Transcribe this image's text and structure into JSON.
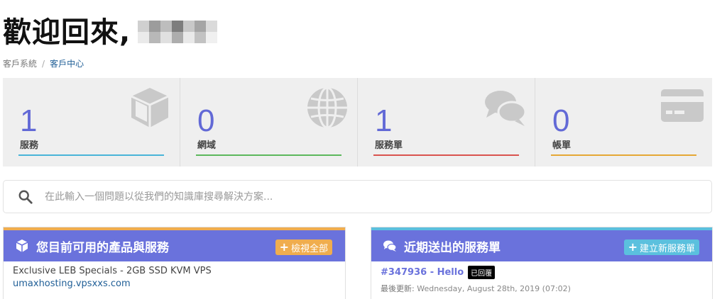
{
  "header": {
    "welcome": "歡迎回來,"
  },
  "breadcrumb": {
    "items": [
      "客戶系統",
      "客戶中心"
    ],
    "separator": "/"
  },
  "tiles": [
    {
      "count": "1",
      "label": "服務",
      "icon": "cube-icon",
      "bar_color": "#49b4d8"
    },
    {
      "count": "0",
      "label": "網域",
      "icon": "globe-icon",
      "bar_color": "#5cb85c"
    },
    {
      "count": "1",
      "label": "服務單",
      "icon": "comments-icon",
      "bar_color": "#d9534f"
    },
    {
      "count": "0",
      "label": "帳單",
      "icon": "credit-card-icon",
      "bar_color": "#e5a835"
    }
  ],
  "search": {
    "placeholder": "在此輸入一個問題以從我們的知識庫搜尋解決方案..."
  },
  "products_panel": {
    "title": "您目前可用的產品與服務",
    "button_label": "檢視全部",
    "accent": "#f0ad4e",
    "items": [
      {
        "name": "Exclusive LEB Specials - 2GB SSD KVM VPS",
        "domain": "umaxhosting.vpsxxs.com"
      }
    ]
  },
  "tickets_panel": {
    "title": "近期送出的服務單",
    "button_label": "建立新服務單",
    "accent": "#5bc0de",
    "items": [
      {
        "id_subject": "#347936 - Hello",
        "status": "已回覆",
        "updated_label": "最後更新:",
        "updated_value": "Wednesday, August 28th, 2019 (07:02)"
      }
    ]
  },
  "colors": {
    "count_text": "#6269d6",
    "panel_header": "#6a72dc",
    "link": "#1f5e96"
  }
}
